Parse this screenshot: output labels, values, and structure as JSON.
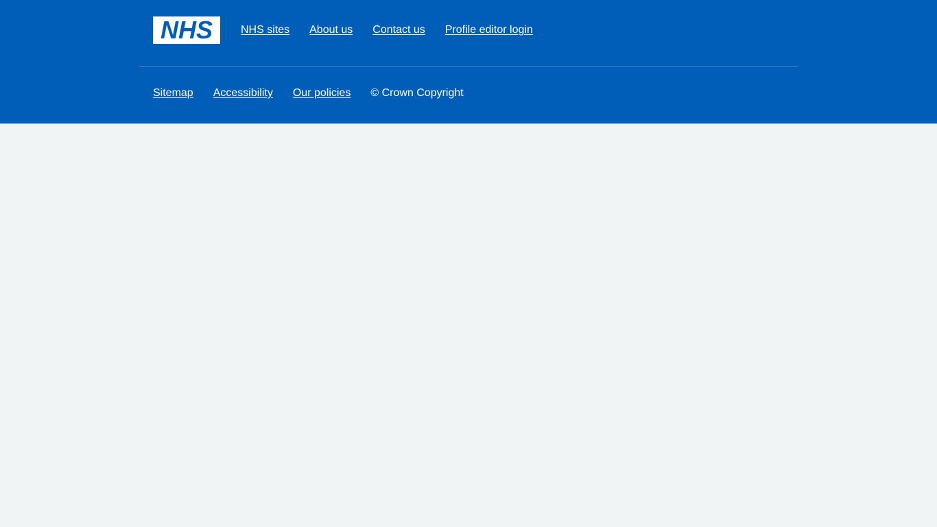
{
  "footer": {
    "logo": {
      "text": "NHS",
      "icon": "nhs-logo"
    },
    "primary_links": [
      {
        "label": "NHS sites"
      },
      {
        "label": "About us"
      },
      {
        "label": "Contact us"
      },
      {
        "label": "Profile editor login"
      }
    ],
    "secondary_links": [
      {
        "label": "Sitemap"
      },
      {
        "label": "Accessibility"
      },
      {
        "label": "Our policies"
      }
    ],
    "copyright": "© Crown Copyright"
  },
  "colors": {
    "footer_background": "#005eb8",
    "page_background": "#f0f4f5",
    "link_text": "#ffffff",
    "logo_background": "#ffffff"
  }
}
